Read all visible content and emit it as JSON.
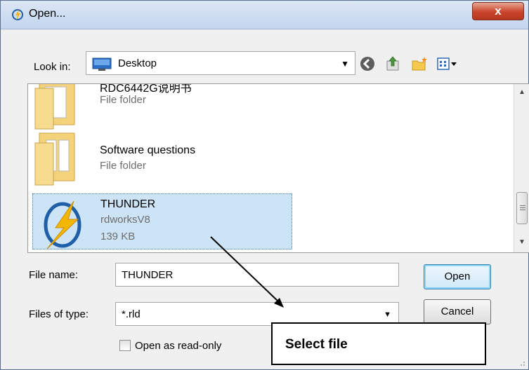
{
  "window": {
    "title": "Open...",
    "close_label": "x"
  },
  "lookin": {
    "label": "Look in:",
    "value": "Desktop"
  },
  "toolbar": {
    "icons": [
      "back-icon",
      "up-folder-icon",
      "new-folder-icon",
      "view-menu-icon"
    ]
  },
  "files": [
    {
      "name": "RDC6442G说明书",
      "type": "File folder",
      "selected": false
    },
    {
      "name": "Software questions",
      "type": "File folder",
      "selected": false
    },
    {
      "name": "THUNDER",
      "type": "rdworksV8",
      "size": "139 KB",
      "selected": true
    }
  ],
  "filename": {
    "label": "File name:",
    "value": "THUNDER"
  },
  "filetype": {
    "label": "Files of type:",
    "value": "*.rld"
  },
  "buttons": {
    "open": "Open",
    "cancel": "Cancel"
  },
  "readonly": {
    "label": "Open as read-only",
    "checked": false
  },
  "callout": {
    "text": "Select file"
  },
  "colors": {
    "selection": "#cde4f7",
    "close_button": "#c8442a",
    "titlebar": "#c3d5ee"
  }
}
